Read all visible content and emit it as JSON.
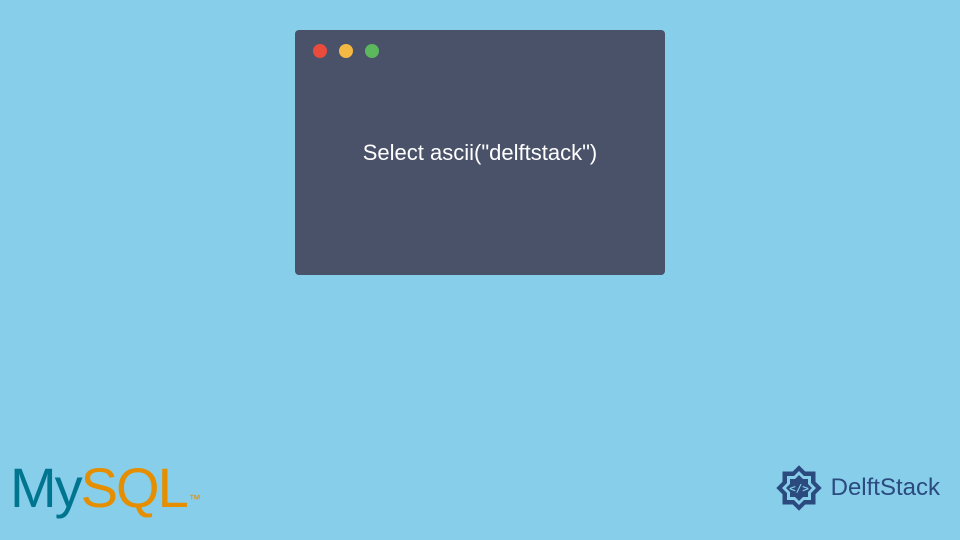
{
  "code_window": {
    "code": "Select ascii(\"delftstack\")"
  },
  "mysql_logo": {
    "my": "My",
    "sql": "SQL",
    "tm": "™"
  },
  "delftstack_logo": {
    "text": "DelftStack"
  }
}
